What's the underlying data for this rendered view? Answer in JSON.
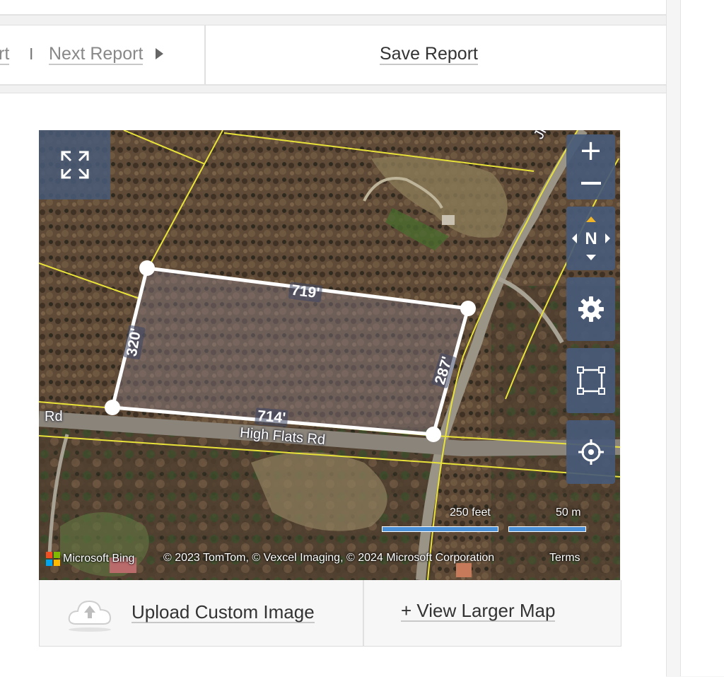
{
  "nav": {
    "prev_report_tail": "rt",
    "separator": "I",
    "next_report": "Next Report",
    "save_report": "Save Report"
  },
  "map": {
    "street_labels": {
      "high_flats": "High Flats Rd",
      "rd_left": "Rd",
      "jim": "Jim C"
    },
    "dimensions": {
      "top": "719'",
      "left": "320'",
      "right": "287'",
      "bottom": "714'"
    },
    "scale": {
      "imperial": "250 feet",
      "metric": "50 m"
    },
    "attribution": {
      "brand": "Microsoft Bing",
      "copyright": "© 2023 TomTom, © Vexcel Imaging, © 2024 Microsoft Corporation",
      "terms": "Terms"
    },
    "controls": {
      "zoom_in": "+",
      "compass_letter": "N"
    }
  },
  "footer": {
    "upload_label": "Upload Custom Image",
    "larger_map_label": "+ View Larger Map"
  },
  "colors": {
    "control_bg": "#485a78",
    "parcel_outline": "#ffffff",
    "lot_lines": "#e8e23a",
    "scale_bar": "#4a90d9"
  }
}
